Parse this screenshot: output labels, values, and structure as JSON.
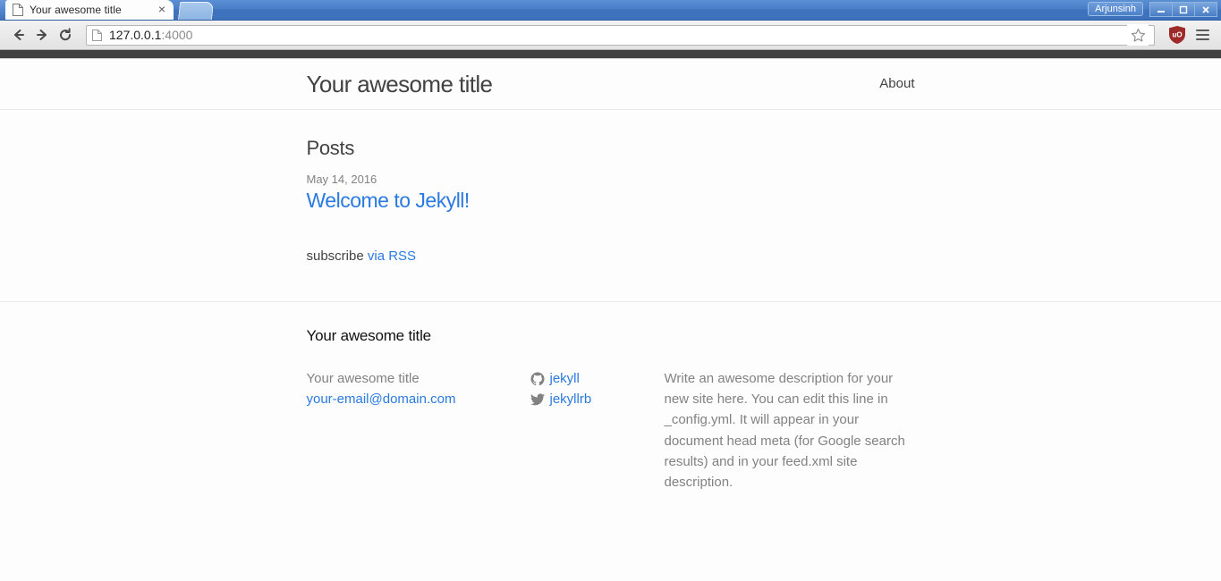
{
  "browser": {
    "tab": {
      "title": "Your awesome title",
      "favicon": "page-icon",
      "close_label": "×"
    },
    "new_tab_label": "+",
    "window": {
      "user_label": "Arjunsinh",
      "minimize_label": "–",
      "maximize_label": "□",
      "close_label": "✕"
    },
    "toolbar": {
      "back_label": "←",
      "forward_label": "→",
      "reload_label": "⟳",
      "url_host": "127.0.0.1",
      "url_port": ":4000",
      "url_full": "127.0.0.1:4000",
      "star_label": "☆",
      "extension_label": "uO",
      "menu_label": "≡"
    }
  },
  "site": {
    "header": {
      "title": "Your awesome title",
      "nav": [
        {
          "label": "About"
        }
      ]
    },
    "main": {
      "posts_heading": "Posts",
      "posts": [
        {
          "date": "May 14, 2016",
          "title": "Welcome to Jekyll!"
        }
      ],
      "subscribe_text": "subscribe",
      "subscribe_link": "via RSS"
    },
    "footer": {
      "heading": "Your awesome title",
      "contact": [
        "Your awesome title"
      ],
      "email": "your-email@domain.com",
      "social": [
        {
          "icon": "github-icon",
          "label": "jekyll"
        },
        {
          "icon": "twitter-icon",
          "label": "jekyllrb"
        }
      ],
      "description": "Write an awesome description for your new site here. You can edit this line in _config.yml. It will appear in your document head meta (for Google search results) and in your feed.xml site description."
    }
  },
  "colors": {
    "link": "#2a7ae2",
    "text": "#424242",
    "muted": "#828282",
    "titlebar": "#3f73bd",
    "dark_strip": "#424242",
    "extension": "#9e2a2a"
  }
}
